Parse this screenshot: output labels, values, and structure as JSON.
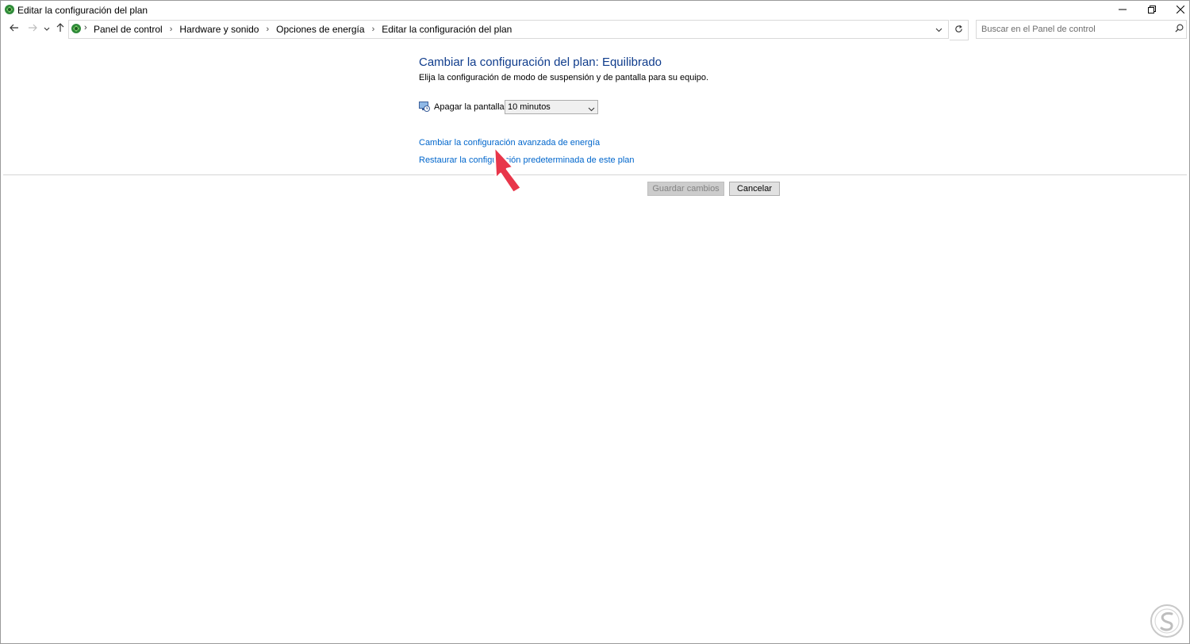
{
  "window": {
    "title": "Editar la configuración del plan"
  },
  "address": {
    "breadcrumbs": [
      "Panel de control",
      "Hardware y sonido",
      "Opciones de energía",
      "Editar la configuración del plan"
    ]
  },
  "search": {
    "placeholder": "Buscar en el Panel de control"
  },
  "content": {
    "heading": "Cambiar la configuración del plan: Equilibrado",
    "subtitle": "Elija la configuración de modo de suspensión y de pantalla para su equipo.",
    "display_off_label": "Apagar la pantalla:",
    "display_off_value": "10 minutos",
    "link_advanced": "Cambiar la configuración avanzada de energía",
    "link_restore": "Restaurar la configuración predeterminada de este plan"
  },
  "buttons": {
    "save": "Guardar cambios",
    "cancel": "Cancelar"
  },
  "colors": {
    "heading": "#0f3c8c",
    "link": "#0066cc",
    "arrow": "#e8364a"
  },
  "icons": [
    "control-panel-icon",
    "minimize-icon",
    "restore-icon",
    "close-icon",
    "back-arrow-icon",
    "forward-arrow-icon",
    "recent-chevron-icon",
    "up-arrow-icon",
    "refresh-icon",
    "search-icon",
    "display-icon",
    "chevron-down-icon",
    "pointer-arrow-icon",
    "watermark-logo"
  ]
}
